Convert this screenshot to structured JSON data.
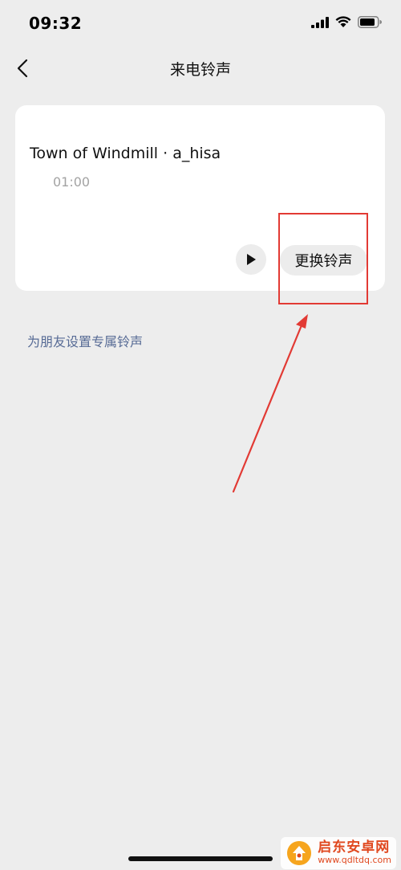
{
  "status_bar": {
    "time": "09:32"
  },
  "nav": {
    "title": "来电铃声"
  },
  "ringtone": {
    "name": "Town of Windmill · a_hisa",
    "duration": "01:00",
    "change_label": "更换铃声"
  },
  "friend_link": {
    "label": "为朋友设置专属铃声"
  },
  "watermark": {
    "name": "启东安卓网",
    "url": "www.qdltdq.com"
  },
  "colors": {
    "background": "#ededed",
    "card": "#ffffff",
    "link": "#576b95",
    "annotation": "#e23a34",
    "watermark": "#e0481f"
  }
}
